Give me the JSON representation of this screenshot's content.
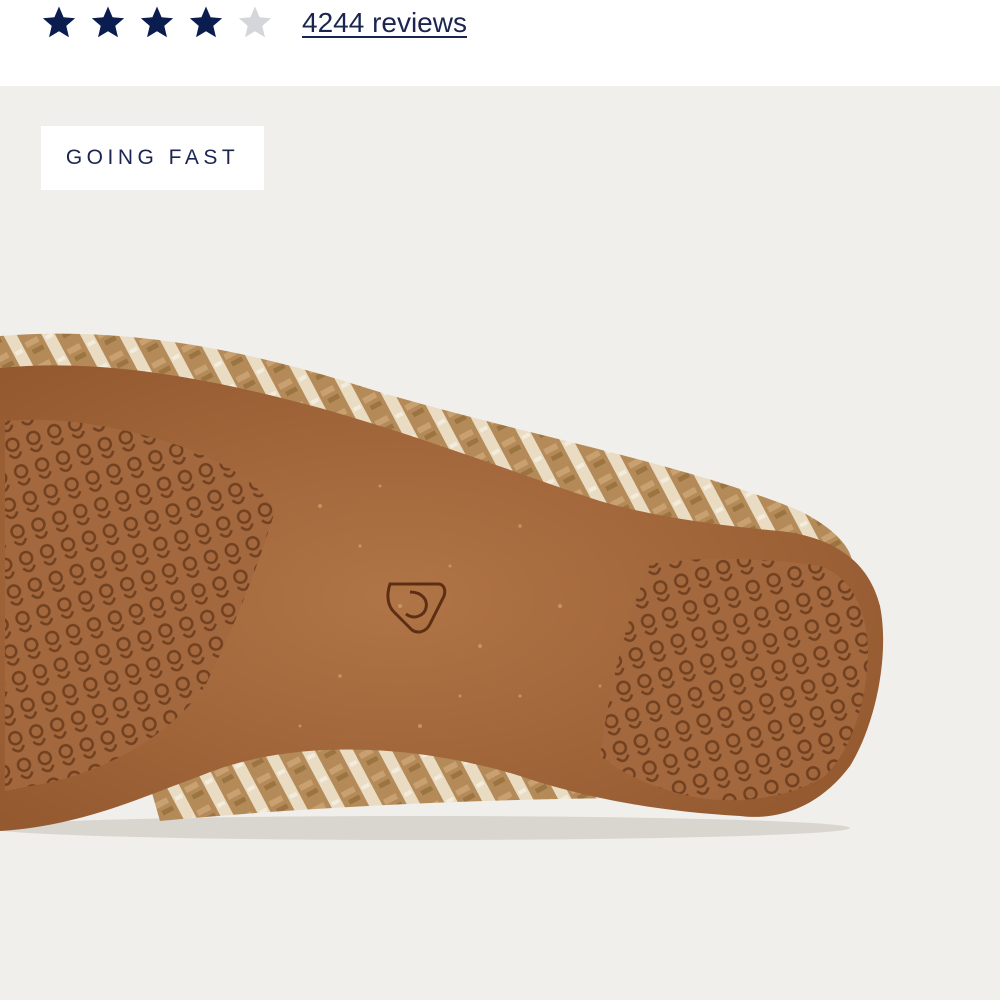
{
  "rating": {
    "value": 4,
    "max": 5,
    "filled_color": "#0b1d4f",
    "empty_color": "#d4d6da",
    "star_icon": "star-icon",
    "reviews_label": "4244 reviews"
  },
  "media": {
    "badge_label": "GOING FAST",
    "image_subject": "shoe sole, tan/brown rubber outsole with knit gold-and-cream upper",
    "background_color": "#f1efec"
  }
}
